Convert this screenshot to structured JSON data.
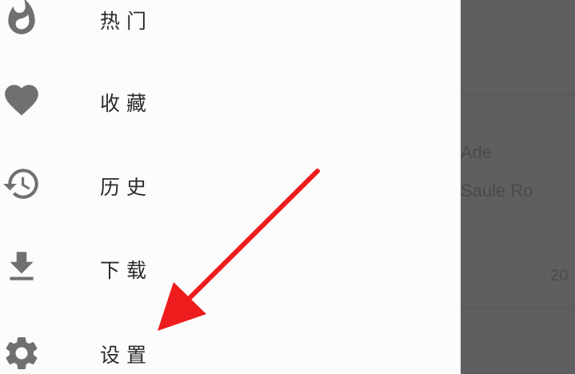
{
  "drawer": {
    "items": [
      {
        "label": "热门",
        "icon": "flame-icon"
      },
      {
        "label": "收藏",
        "icon": "heart-icon"
      },
      {
        "label": "历史",
        "icon": "history-icon"
      },
      {
        "label": "下载",
        "icon": "download-icon"
      },
      {
        "label": "设置",
        "icon": "gear-icon"
      }
    ]
  },
  "background": {
    "text_1": "Ade",
    "text_2": "Saule Ro",
    "text_3": "20"
  },
  "colors": {
    "icon": "#707070",
    "scrim": "#5f5e60",
    "annotation_arrow": "#ee1c1c"
  }
}
